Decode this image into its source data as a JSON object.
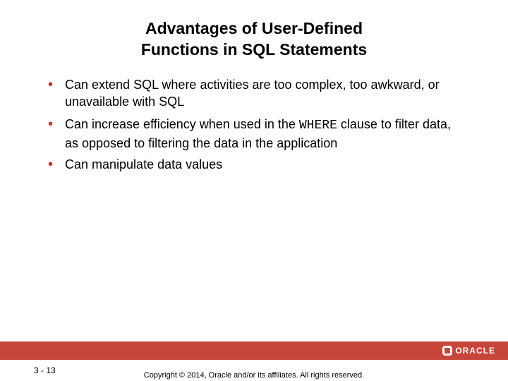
{
  "title_line1": "Advantages of User-Defined",
  "title_line2": "Functions in SQL Statements",
  "bullets": [
    {
      "pre": "Can extend SQL where activities are too complex, too awkward, or unavailable with SQL",
      "code": "",
      "post": ""
    },
    {
      "pre": "Can increase efficiency when used in the ",
      "code": "WHERE",
      "post": " clause to filter data, as opposed to filtering the data in the application"
    },
    {
      "pre": "Can manipulate data values",
      "code": "",
      "post": ""
    }
  ],
  "logo_text": "ORACLE",
  "page_number": "3 - 13",
  "copyright": "Copyright © 2014, Oracle and/or its affiliates. All rights reserved."
}
